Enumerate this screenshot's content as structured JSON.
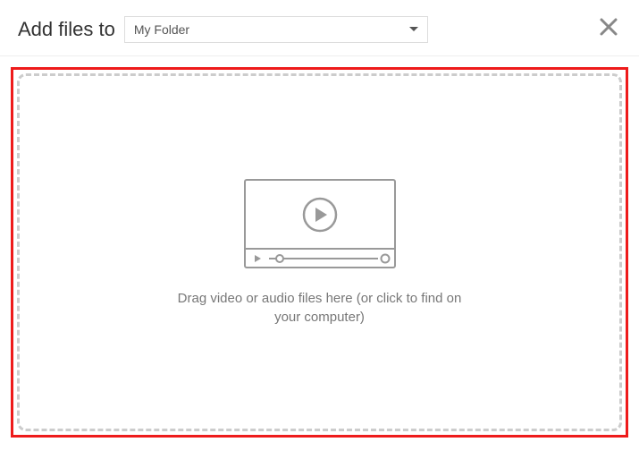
{
  "header": {
    "title": "Add files to",
    "folder_selected": "My Folder"
  },
  "dropzone": {
    "instruction": "Drag video or audio files here (or click to find on your computer)"
  }
}
